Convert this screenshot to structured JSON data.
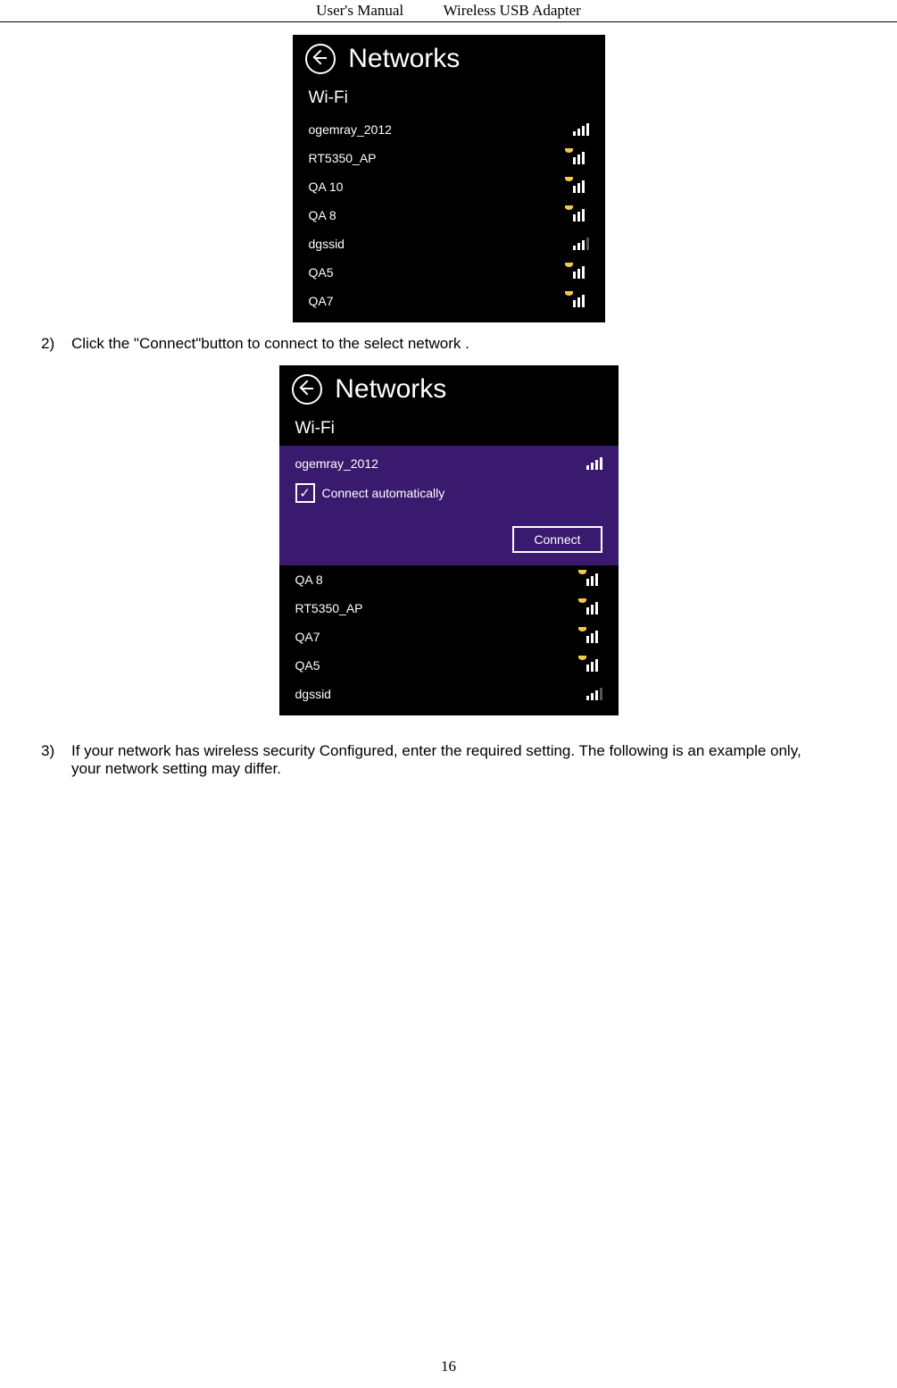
{
  "header": {
    "left": "User's Manual",
    "right": "Wireless USB Adapter"
  },
  "page_number": "16",
  "fig1": {
    "title": "Networks",
    "section": "Wi-Fi",
    "items": [
      {
        "ssid": "ogemray_2012",
        "secured": false,
        "strength": 4
      },
      {
        "ssid": "RT5350_AP",
        "secured": true,
        "strength": 4
      },
      {
        "ssid": "QA 10",
        "secured": true,
        "strength": 4
      },
      {
        "ssid": "QA 8",
        "secured": true,
        "strength": 3
      },
      {
        "ssid": "dgssid",
        "secured": false,
        "strength": 3
      },
      {
        "ssid": "QA5",
        "secured": true,
        "strength": 3
      },
      {
        "ssid": "QA7",
        "secured": true,
        "strength": 3
      }
    ]
  },
  "step2": {
    "num": "2)",
    "text": "Click the \"Connect\"button to connect to the select network ."
  },
  "fig2": {
    "title": "Networks",
    "section": "Wi-Fi",
    "selected": {
      "ssid": "ogemray_2012",
      "secured": false,
      "strength": 4,
      "auto_label": "Connect automatically",
      "connect_label": "Connect"
    },
    "items": [
      {
        "ssid": "QA 8",
        "secured": true,
        "strength": 4
      },
      {
        "ssid": "RT5350_AP",
        "secured": true,
        "strength": 4
      },
      {
        "ssid": "QA7",
        "secured": true,
        "strength": 3
      },
      {
        "ssid": "QA5",
        "secured": true,
        "strength": 3
      },
      {
        "ssid": "dgssid",
        "secured": false,
        "strength": 3
      }
    ]
  },
  "step3": {
    "num": "3)",
    "text": "If your network has wireless security Configured, enter the required setting. The following is an example only, your network setting may differ."
  }
}
